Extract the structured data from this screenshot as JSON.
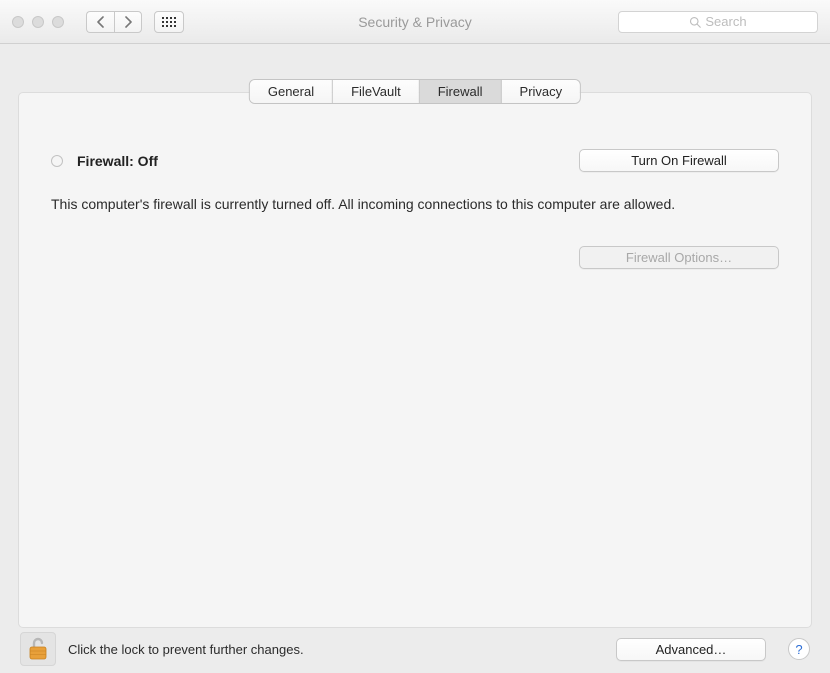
{
  "window": {
    "title": "Security & Privacy",
    "search_placeholder": "Search"
  },
  "tabs": {
    "items": [
      {
        "label": "General",
        "name": "tab-general"
      },
      {
        "label": "FileVault",
        "name": "tab-filevault"
      },
      {
        "label": "Firewall",
        "name": "tab-firewall"
      },
      {
        "label": "Privacy",
        "name": "tab-privacy"
      }
    ],
    "active_index": 2
  },
  "firewall": {
    "status_label": "Firewall: Off",
    "turn_on_label": "Turn On Firewall",
    "description": "This computer's firewall is currently turned off. All incoming connections to this computer are allowed.",
    "options_label": "Firewall Options…",
    "options_enabled": false
  },
  "footer": {
    "lock_hint": "Click the lock to prevent further changes.",
    "advanced_label": "Advanced…",
    "help_label": "?"
  }
}
